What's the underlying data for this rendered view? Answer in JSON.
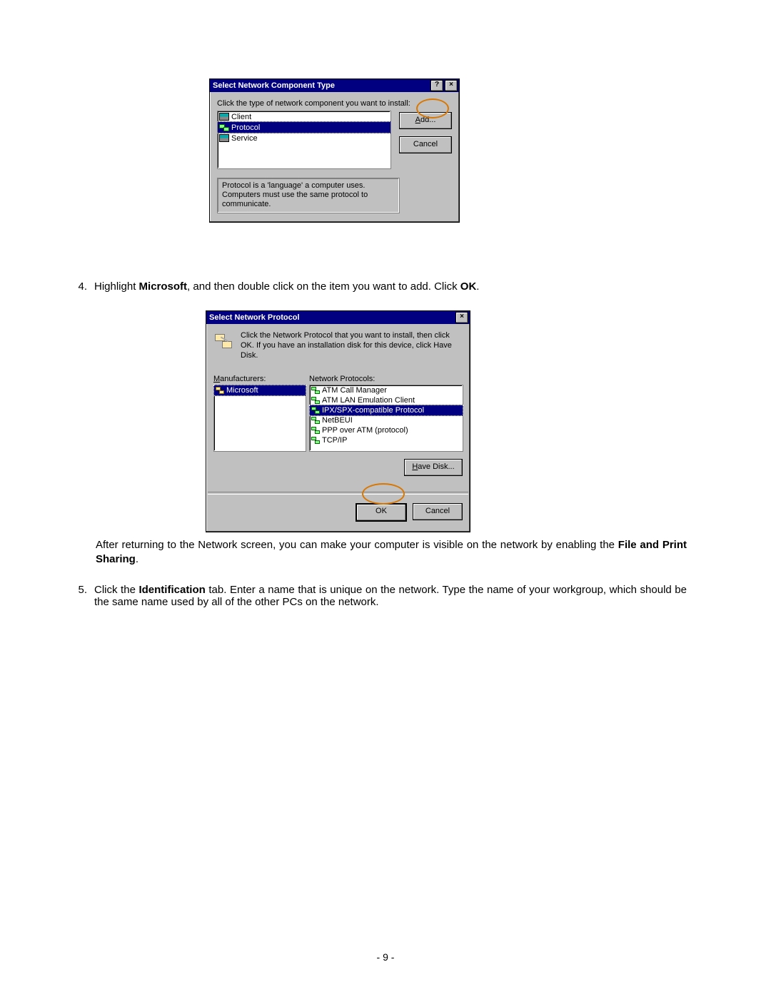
{
  "dialog1": {
    "title": "Select Network Component Type",
    "instruction": "Click the type of network component you want to install:",
    "items": {
      "client": "Client",
      "protocol": "Protocol",
      "service": "Service"
    },
    "add": "Add...",
    "cancel": "Cancel",
    "description": "Protocol is a 'language' a computer uses. Computers must use the same protocol to communicate."
  },
  "step4": {
    "num": "4.",
    "pre": "Highlight ",
    "b1": "Microsoft",
    "mid": ", and then double click on the item you want to add. Click ",
    "b2": "OK",
    "post": "."
  },
  "dialog2": {
    "title": "Select Network Protocol",
    "instruction": "Click the Network Protocol that you want to install, then click OK. If you have an installation disk for this device, click Have Disk.",
    "manuf_label": "Manufacturers:",
    "proto_label": "Network Protocols:",
    "manufacturers": {
      "microsoft": "Microsoft"
    },
    "protocols": {
      "atm_call": "ATM Call Manager",
      "atm_lan": "ATM LAN Emulation Client",
      "ipxspx": "IPX/SPX-compatible Protocol",
      "netbeui": "NetBEUI",
      "ppp_atm": "PPP over ATM (protocol)",
      "tcpip": "TCP/IP"
    },
    "have_disk": "Have Disk...",
    "ok": "OK",
    "cancel": "Cancel"
  },
  "after_text": {
    "pre": "After returning to the Network screen, you can make your computer is visible on the network by enabling the ",
    "b": "File and Print Sharing",
    "post": "."
  },
  "step5": {
    "num": "5.",
    "pre": "Click the ",
    "b": "Identification",
    "post": " tab. Enter a name that is unique on the network.  Type the name of your workgroup, which should be the same name used by all of the other PCs on the network."
  },
  "page_num": "- 9 -"
}
